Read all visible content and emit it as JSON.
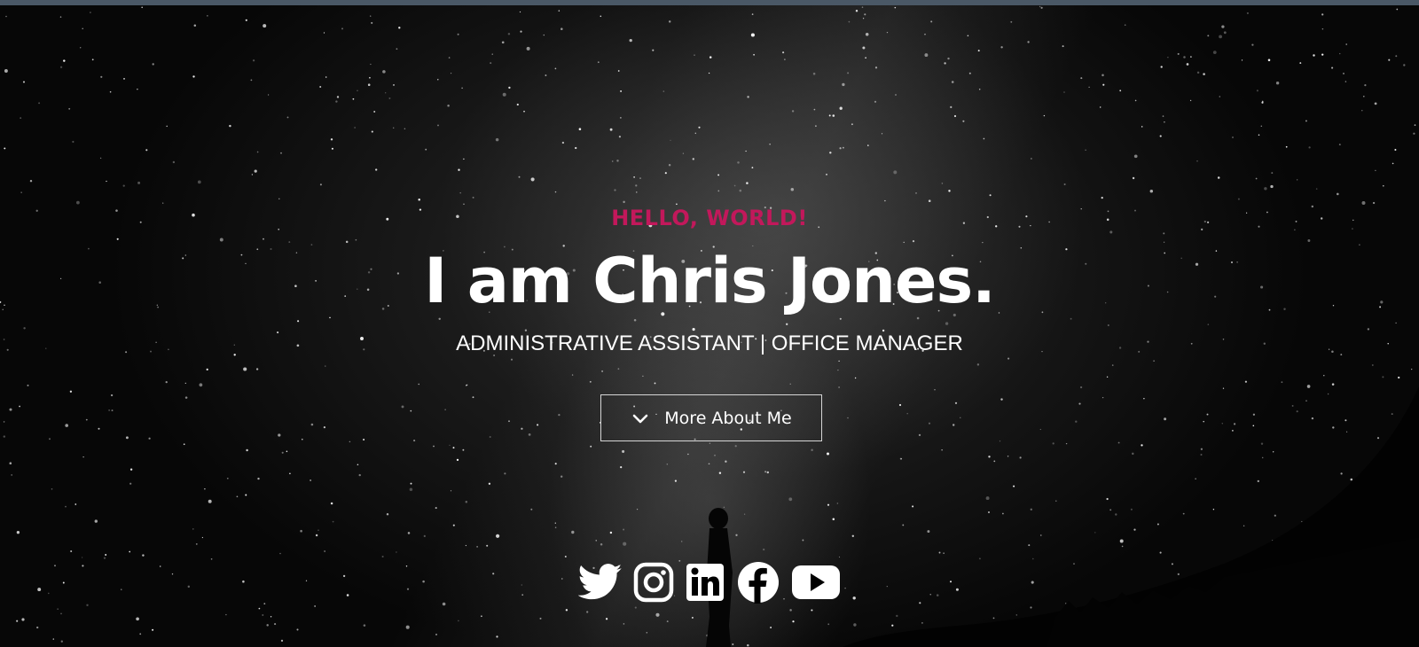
{
  "hero": {
    "greeting": "HELLO, WORLD!",
    "name": "I am Chris Jones.",
    "subtitle": "ADMINISTRATIVE ASSISTANT | OFFICE MANAGER",
    "cta_label": "More About Me",
    "cta_icon": "chevron-down-icon"
  },
  "social": [
    {
      "icon": "twitter-icon"
    },
    {
      "icon": "instagram-icon"
    },
    {
      "icon": "linkedin-icon"
    },
    {
      "icon": "facebook-icon"
    },
    {
      "icon": "youtube-icon"
    }
  ],
  "colors": {
    "accent": "#c2185b",
    "text": "#ffffff",
    "background": "#000000",
    "topbar": "#4a5866"
  }
}
